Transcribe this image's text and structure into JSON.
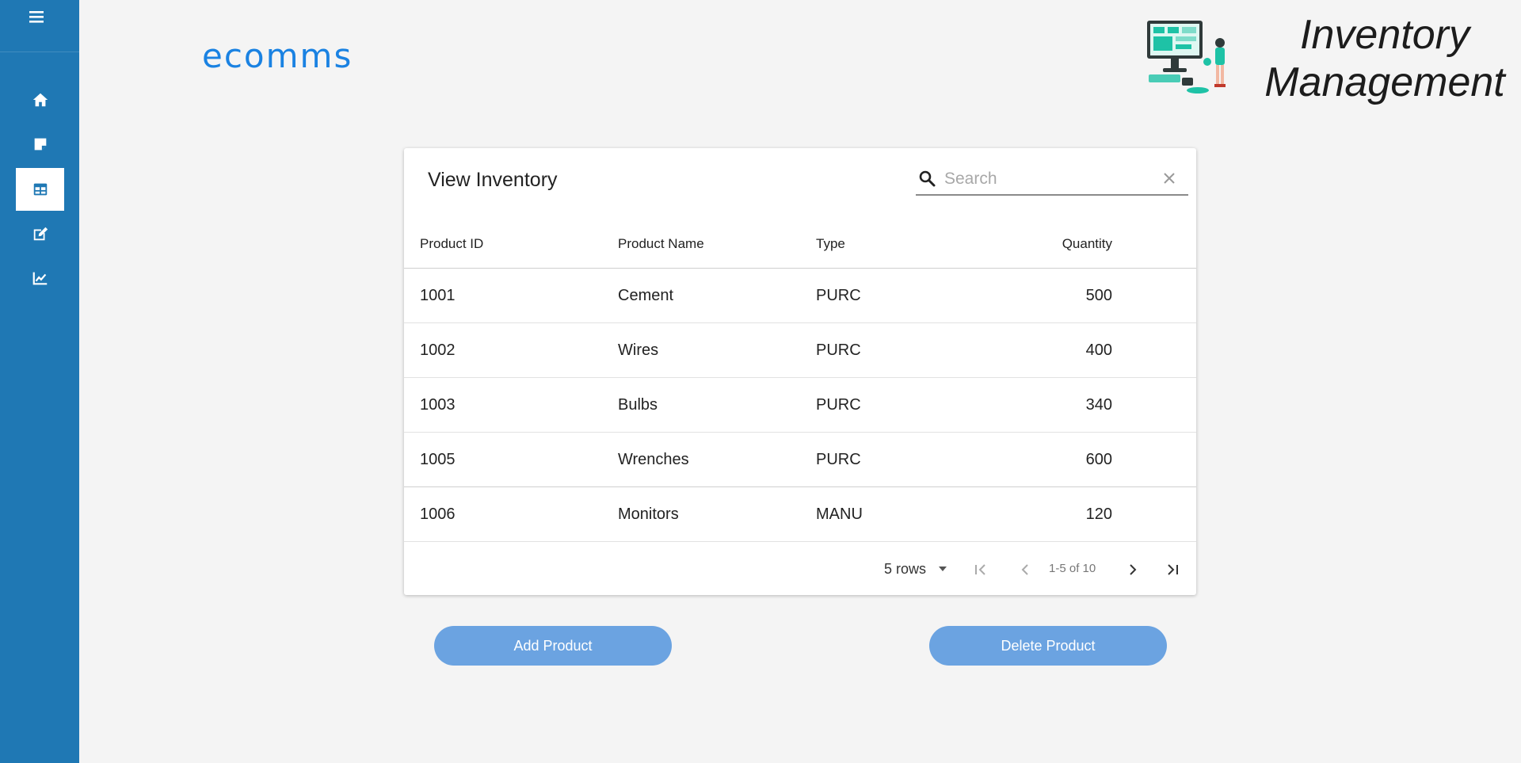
{
  "brand": "ecomms",
  "banner": {
    "title": "Inventory Management"
  },
  "sidebar": {
    "items": [
      {
        "icon": "home-icon"
      },
      {
        "icon": "note-icon"
      },
      {
        "icon": "table-icon",
        "active": true
      },
      {
        "icon": "edit-icon"
      },
      {
        "icon": "chart-icon"
      }
    ]
  },
  "card": {
    "title": "View Inventory",
    "search": {
      "placeholder": "Search",
      "value": ""
    },
    "columns": [
      "Product ID",
      "Product Name",
      "Type",
      "Quantity"
    ],
    "rows": [
      {
        "id": "1001",
        "name": "Cement",
        "type": "PURC",
        "qty": "500"
      },
      {
        "id": "1002",
        "name": "Wires",
        "type": "PURC",
        "qty": "400"
      },
      {
        "id": "1003",
        "name": "Bulbs",
        "type": "PURC",
        "qty": "340"
      },
      {
        "id": "1005",
        "name": "Wrenches",
        "type": "PURC",
        "qty": "600"
      },
      {
        "id": "1006",
        "name": "Monitors",
        "type": "MANU",
        "qty": "120"
      }
    ],
    "pagination": {
      "rows_per_page": "5 rows",
      "range": "1-5 of 10"
    }
  },
  "actions": {
    "add": "Add Product",
    "delete": "Delete Product"
  },
  "colors": {
    "sidebar": "#1f78b4",
    "brand": "#1a82e2",
    "button": "#6ba3e1",
    "accent": "#1ec2a6"
  }
}
